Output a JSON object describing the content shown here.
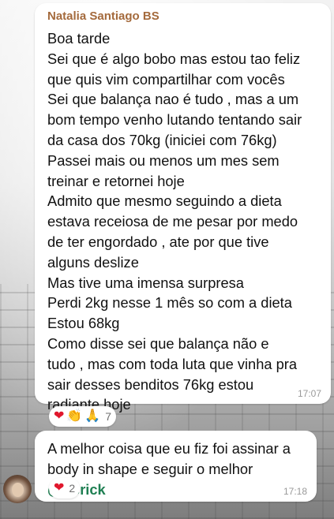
{
  "colors": {
    "sender_name": "#a46a3c",
    "mention": "#1e7f52",
    "bubble": "#ffffff",
    "timestamp": "#9a9a9a"
  },
  "messages": [
    {
      "sender": "Natalia Santiago BS",
      "lines": [
        "Boa tarde",
        "Sei que é algo bobo mas estou tao feliz",
        "que quis vim compartilhar com vocês",
        "Sei que balança nao é tudo , mas a um",
        "bom tempo venho lutando tentando sair",
        "da casa dos 70kg (iniciei com 76kg)",
        "Passei mais ou menos um mes sem",
        "treinar e retornei hoje",
        "Admito que mesmo seguindo a dieta",
        "estava receiosa de me pesar por medo",
        "de ter engordado , ate por que tive",
        "alguns deslize",
        "Mas tive uma imensa surpresa",
        "Perdi 2kg nesse 1 mês so com a dieta",
        "Estou 68kg",
        "Como disse sei que balança não e",
        "tudo , mas com toda luta que vinha pra",
        "sair desses benditos 76kg estou",
        "radiante hoje"
      ],
      "time": "17:07",
      "reactions": {
        "emojis": [
          {
            "icon": "heart-icon",
            "glyph": "❤"
          },
          {
            "icon": "clapping-hands-icon",
            "glyph": "👏"
          },
          {
            "icon": "praying-hands-icon",
            "glyph": "🙏"
          }
        ],
        "count": "7"
      }
    },
    {
      "lines": [
        "A melhor coisa que eu fiz foi assinar a",
        "body in shape e seguir o melhor"
      ],
      "mention": "@Herick",
      "time": "17:18",
      "reactions": {
        "emojis": [
          {
            "icon": "heart-icon",
            "glyph": "❤"
          }
        ],
        "count": "2"
      }
    }
  ]
}
